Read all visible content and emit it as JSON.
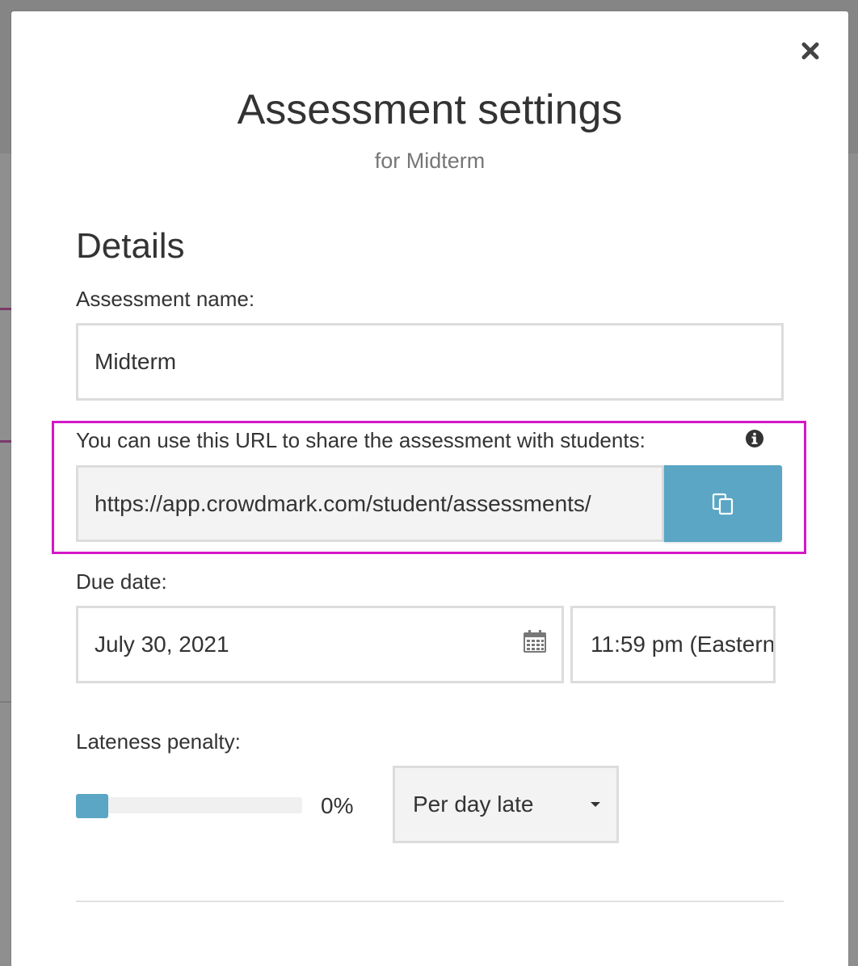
{
  "modal": {
    "title": "Assessment settings",
    "subtitle": "for Midterm",
    "close_icon": "close-icon"
  },
  "details": {
    "heading": "Details",
    "name_label": "Assessment name:",
    "name_value": "Midterm",
    "share_label": "You can use this URL to share the assessment with students:",
    "share_info_icon": "info-icon",
    "share_url": "https://app.crowdmark.com/student/assessments/",
    "copy_icon": "copy-icon",
    "due_label": "Due date:",
    "due_date_value": "July 30, 2021",
    "calendar_icon": "calendar-icon",
    "due_time_value": "11:59 pm (Eastern",
    "penalty_label": "Lateness penalty:",
    "penalty_percent": 0,
    "penalty_value_text": "0%",
    "penalty_mode": "Per day late"
  },
  "next_section": {
    "heading_partial": ""
  },
  "colors": {
    "accent": "#5aa6c4",
    "highlight": "#d417c7",
    "text": "#333333",
    "muted": "#777777"
  }
}
